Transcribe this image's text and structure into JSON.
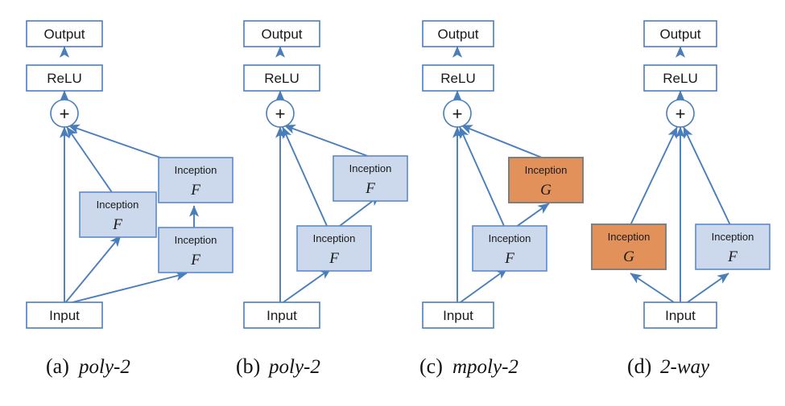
{
  "figure": {
    "background_color": "#ffffff",
    "edge_color": "#4a7ebb",
    "plain_box": {
      "fill": "#ffffff",
      "stroke": "#4a7ebb"
    },
    "blue_box": {
      "fill": "#ccd9ed",
      "stroke": "#5b8bc9"
    },
    "orange_box": {
      "fill": "#e2915a",
      "stroke": "#7f7f7f"
    }
  },
  "common_labels": {
    "output": "Output",
    "relu": "ReLU",
    "input": "Input",
    "plus": "+",
    "inception": "Inception",
    "fn_F": "F",
    "fn_G": "G"
  },
  "panels": [
    {
      "id": "panel-a",
      "caption_index": "(a)",
      "caption_name": "poly-2",
      "blocks": [
        {
          "name": "output",
          "label": "Output",
          "style": "plain"
        },
        {
          "name": "relu",
          "label": "ReLU",
          "style": "plain"
        },
        {
          "name": "sum",
          "label": "+",
          "style": "circle"
        },
        {
          "name": "inception-left",
          "label": "Inception",
          "fn": "F",
          "style": "blue"
        },
        {
          "name": "inception-right-top",
          "label": "Inception",
          "fn": "F",
          "style": "blue"
        },
        {
          "name": "inception-right-bottom",
          "label": "Inception",
          "fn": "F",
          "style": "blue"
        },
        {
          "name": "input",
          "label": "Input",
          "style": "plain"
        }
      ],
      "edges": [
        "relu->output",
        "sum->relu",
        "input->sum",
        "input->inception-left",
        "input->inception-right-bottom",
        "inception-right-bottom->inception-right-top",
        "inception-left->sum",
        "inception-right-top->sum"
      ]
    },
    {
      "id": "panel-b",
      "caption_index": "(b)",
      "caption_name": "poly-2",
      "blocks": [
        {
          "name": "output",
          "label": "Output",
          "style": "plain"
        },
        {
          "name": "relu",
          "label": "ReLU",
          "style": "plain"
        },
        {
          "name": "sum",
          "label": "+",
          "style": "circle"
        },
        {
          "name": "inception-upper",
          "label": "Inception",
          "fn": "F",
          "style": "blue"
        },
        {
          "name": "inception-lower",
          "label": "Inception",
          "fn": "F",
          "style": "blue"
        },
        {
          "name": "input",
          "label": "Input",
          "style": "plain"
        }
      ],
      "edges": [
        "relu->output",
        "sum->relu",
        "input->sum",
        "input->inception-lower",
        "inception-lower->inception-upper",
        "inception-lower->sum",
        "inception-upper->sum"
      ]
    },
    {
      "id": "panel-c",
      "caption_index": "(c)",
      "caption_name": "mpoly-2",
      "blocks": [
        {
          "name": "output",
          "label": "Output",
          "style": "plain"
        },
        {
          "name": "relu",
          "label": "ReLU",
          "style": "plain"
        },
        {
          "name": "sum",
          "label": "+",
          "style": "circle"
        },
        {
          "name": "inception-upper",
          "label": "Inception",
          "fn": "G",
          "style": "orange"
        },
        {
          "name": "inception-lower",
          "label": "Inception",
          "fn": "F",
          "style": "blue"
        },
        {
          "name": "input",
          "label": "Input",
          "style": "plain"
        }
      ],
      "edges": [
        "relu->output",
        "sum->relu",
        "input->sum",
        "input->inception-lower",
        "inception-lower->inception-upper",
        "inception-lower->sum",
        "inception-upper->sum"
      ]
    },
    {
      "id": "panel-d",
      "caption_index": "(d)",
      "caption_name": "2-way",
      "blocks": [
        {
          "name": "output",
          "label": "Output",
          "style": "plain"
        },
        {
          "name": "relu",
          "label": "ReLU",
          "style": "plain"
        },
        {
          "name": "sum",
          "label": "+",
          "style": "circle"
        },
        {
          "name": "inception-left",
          "label": "Inception",
          "fn": "G",
          "style": "orange"
        },
        {
          "name": "inception-right",
          "label": "Inception",
          "fn": "F",
          "style": "blue"
        },
        {
          "name": "input",
          "label": "Input",
          "style": "plain"
        }
      ],
      "edges": [
        "relu->output",
        "sum->relu",
        "input->sum",
        "input->inception-left",
        "input->inception-right",
        "inception-left->sum",
        "inception-right->sum"
      ]
    }
  ]
}
